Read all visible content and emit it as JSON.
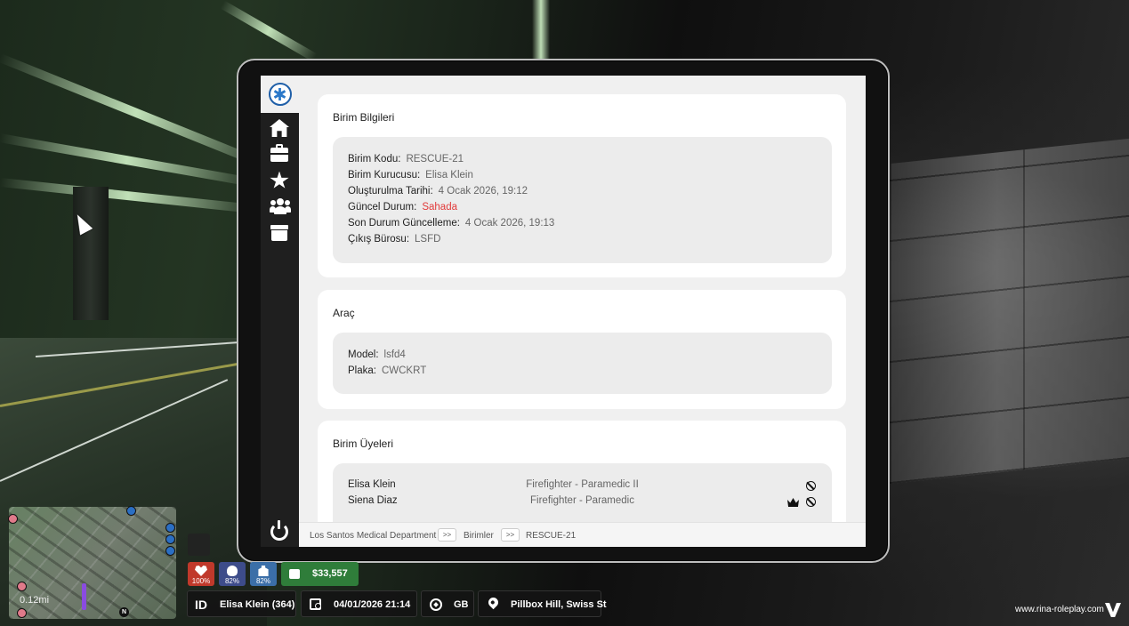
{
  "tablet": {
    "sidebar": {
      "logo": "ems-star-of-life-icon",
      "items": [
        {
          "icon": "home-icon"
        },
        {
          "icon": "briefcase-icon"
        },
        {
          "icon": "star-icon"
        },
        {
          "icon": "users-icon"
        },
        {
          "icon": "archive-icon"
        }
      ],
      "power": "power-icon"
    },
    "unit_info": {
      "title": "Birim Bilgileri",
      "fields": [
        {
          "label": "Birim Kodu:",
          "value": "RESCUE-21"
        },
        {
          "label": "Birim Kurucusu:",
          "value": "Elisa Klein"
        },
        {
          "label": "Oluşturulma Tarihi:",
          "value": "4 Ocak 2026, 19:12"
        },
        {
          "label": "Güncel Durum:",
          "value": "Sahada"
        },
        {
          "label": "Son Durum Güncelleme:",
          "value": "4 Ocak 2026, 19:13"
        },
        {
          "label": "Çıkış Bürosu:",
          "value": "LSFD"
        }
      ],
      "status_color": "#e23b3b"
    },
    "vehicle": {
      "title": "Araç",
      "fields": [
        {
          "label": "Model:",
          "value": "lsfd4"
        },
        {
          "label": "Plaka:",
          "value": "CWCKRT"
        }
      ]
    },
    "members": {
      "title": "Birim Üyeleri",
      "rows": [
        {
          "name": "Elisa Klein",
          "rank": "Firefighter - Paramedic II",
          "leader": false
        },
        {
          "name": "Siena Diaz",
          "rank": "Firefighter - Paramedic",
          "leader": true
        }
      ]
    },
    "breadcrumb": {
      "items": [
        "Los Santos Medical Department",
        "Birimler",
        "RESCUE-21"
      ],
      "separator": ">>"
    }
  },
  "hud": {
    "minimap": {
      "distance": "0.12mi",
      "north": "N"
    },
    "stats": [
      {
        "icon": "heart-icon",
        "value": "100%",
        "color": "#c0392b"
      },
      {
        "icon": "food-icon",
        "value": "82%",
        "color": "#3d4c8a"
      },
      {
        "icon": "water-icon",
        "value": "82%",
        "color": "#3b6fa8"
      }
    ],
    "money": "$33,557",
    "player": {
      "id_label": "ID",
      "name": "Elisa Klein (364)"
    },
    "datetime": "04/01/2026 21:14",
    "region": "GB",
    "location": "Pillbox Hill, Swiss St"
  },
  "watermark": "www.rina-roleplay.com"
}
